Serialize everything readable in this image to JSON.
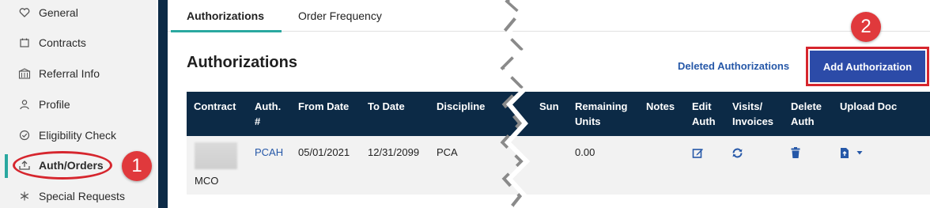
{
  "sidebar": {
    "items": [
      {
        "label": "General",
        "icon": "heart-icon"
      },
      {
        "label": "Contracts",
        "icon": "calendar-icon"
      },
      {
        "label": "Referral Info",
        "icon": "hospital-icon"
      },
      {
        "label": "Profile",
        "icon": "person-icon"
      },
      {
        "label": "Eligibility Check",
        "icon": "check-circle-icon"
      },
      {
        "label": "Auth/Orders",
        "icon": "upload-tray-icon",
        "active": true
      },
      {
        "label": "Special Requests",
        "icon": "asterisk-icon"
      }
    ]
  },
  "callouts": {
    "one": "1",
    "two": "2"
  },
  "tabs": [
    {
      "label": "Authorizations",
      "active": true
    },
    {
      "label": "Order Frequency",
      "active": false
    }
  ],
  "main": {
    "title": "Authorizations",
    "deleted_link": "Deleted Authorizations",
    "add_button": "Add Authorization"
  },
  "table": {
    "headers": {
      "contract": "Contract",
      "auth_line1": "Auth.",
      "auth_line2": "#",
      "from_date": "From Date",
      "to_date": "To Date",
      "discipline": "Discipline",
      "sun": "Sun",
      "remaining_line1": "Remaining",
      "remaining_line2": "Units",
      "notes": "Notes",
      "edit_line1": "Edit",
      "edit_line2": "Auth",
      "visits_line1": "Visits/",
      "visits_line2": "Invoices",
      "delete_line1": "Delete",
      "delete_line2": "Auth",
      "upload": "Upload Doc"
    },
    "rows": [
      {
        "contract": "MCO",
        "auth": "PCAH",
        "from_date": "05/01/2021",
        "to_date": "12/31/2099",
        "discipline": "PCA",
        "remaining_units": "0.00"
      }
    ]
  },
  "colors": {
    "navy": "#0c2a46",
    "accent_teal": "#2aa8a0",
    "button_blue": "#2c4ba8",
    "link_blue": "#2658a8",
    "annotation_red": "#d6262e"
  }
}
